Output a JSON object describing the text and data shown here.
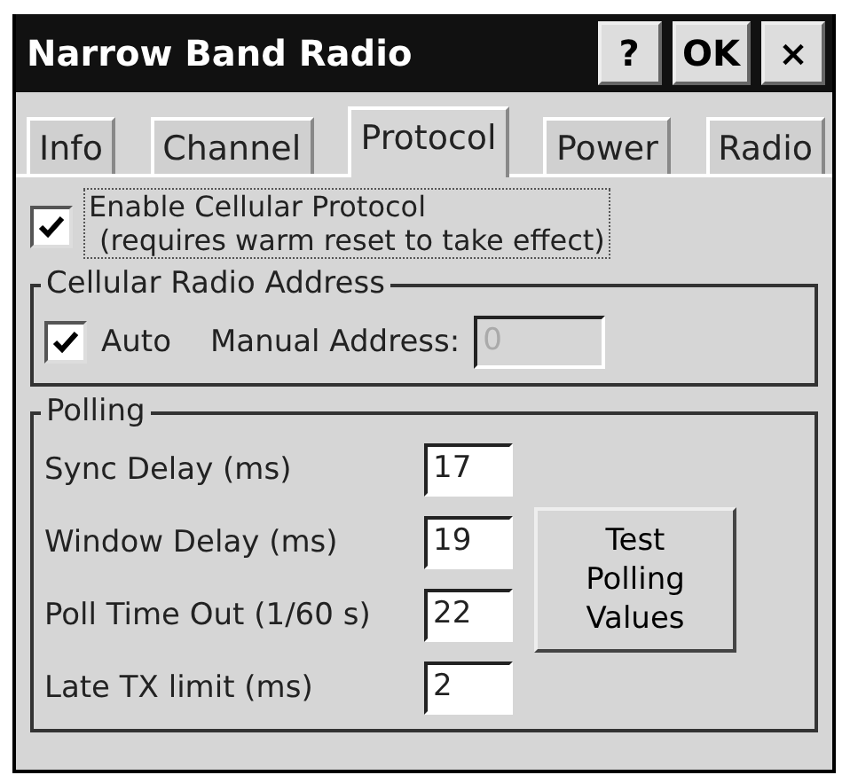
{
  "window": {
    "title": "Narrow Band Radio",
    "buttons": [
      {
        "label": "?"
      },
      {
        "label": "OK"
      },
      {
        "label": "×"
      }
    ]
  },
  "tabs": [
    {
      "label": "Info",
      "selected": false
    },
    {
      "label": "Channel",
      "selected": false
    },
    {
      "label": "Protocol",
      "selected": true
    },
    {
      "label": "Power",
      "selected": false
    },
    {
      "label": "Radio",
      "selected": false
    }
  ],
  "enable_protocol": {
    "label": "Enable Cellular Protocol",
    "note": "(requires warm reset to take effect)",
    "checked": true
  },
  "cellular_radio_address": {
    "title": "Cellular Radio Address",
    "auto": {
      "label": "Auto",
      "checked": true
    },
    "manual_label": "Manual Address:",
    "manual_value": "0",
    "manual_disabled": true
  },
  "polling": {
    "title": "Polling",
    "fields": [
      {
        "label": "Sync Delay (ms)",
        "value": "17"
      },
      {
        "label": "Window Delay (ms)",
        "value": "19"
      },
      {
        "label": "Poll Time Out (1/60 s)",
        "value": "22"
      },
      {
        "label": "Late TX limit (ms)",
        "value": "2"
      }
    ],
    "test_button": "Test Polling Values"
  }
}
